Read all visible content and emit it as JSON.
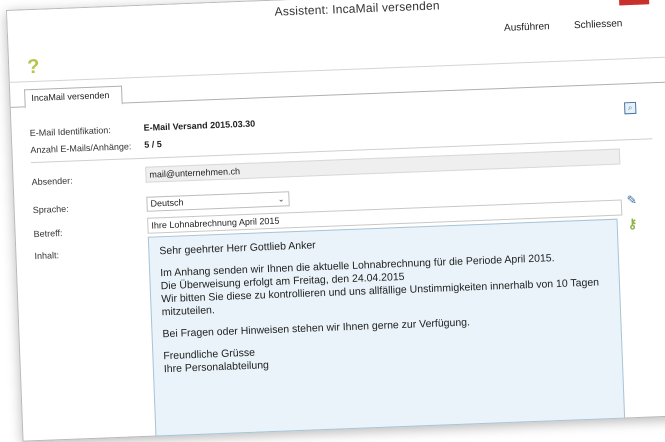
{
  "window": {
    "title": "Assistent: IncaMail versenden",
    "close_glyph": "×"
  },
  "toolbar": {
    "run_label": "Ausführen",
    "close_label": "Schliessen",
    "help_icon": "question-icon"
  },
  "tabs": [
    {
      "label": "IncaMail versenden"
    }
  ],
  "info": {
    "id_label": "E-Mail Identifikation:",
    "id_value": "E-Mail Versand 2015.03.30",
    "count_label": "Anzahl E-Mails/Anhänge:",
    "count_value": "5 / 5"
  },
  "form": {
    "sender_label": "Absender:",
    "sender_value": "mail@unternehmen.ch",
    "language_label": "Sprache:",
    "language_value": "Deutsch",
    "subject_label": "Betreff:",
    "subject_value": "Ihre Lohnabrechnung April 2015",
    "body_label": "Inhalt:",
    "body_lines": {
      "l1": "Sehr geehrter Herr Gottlieb Anker",
      "l2": "Im Anhang senden wir Ihnen die aktuelle Lohnabrechnung für die Periode April 2015.",
      "l3": "Die Überweisung erfolgt am Freitag, den 24.04.2015",
      "l4": "Wir bitten Sie diese zu kontrollieren und uns allfällige Unstimmigkeiten innerhalb von 10 Tagen",
      "l5": "mitzuteilen.",
      "l6": "Bei Fragen oder Hinweisen stehen wir Ihnen gerne zur Verfügung.",
      "l7": "Freundliche Grüsse",
      "l8": "Ihre Personalabteilung"
    }
  },
  "colors": {
    "close_red": "#c9302c",
    "help_yellow": "#b8c44a",
    "body_bg": "#e9f3f9"
  }
}
